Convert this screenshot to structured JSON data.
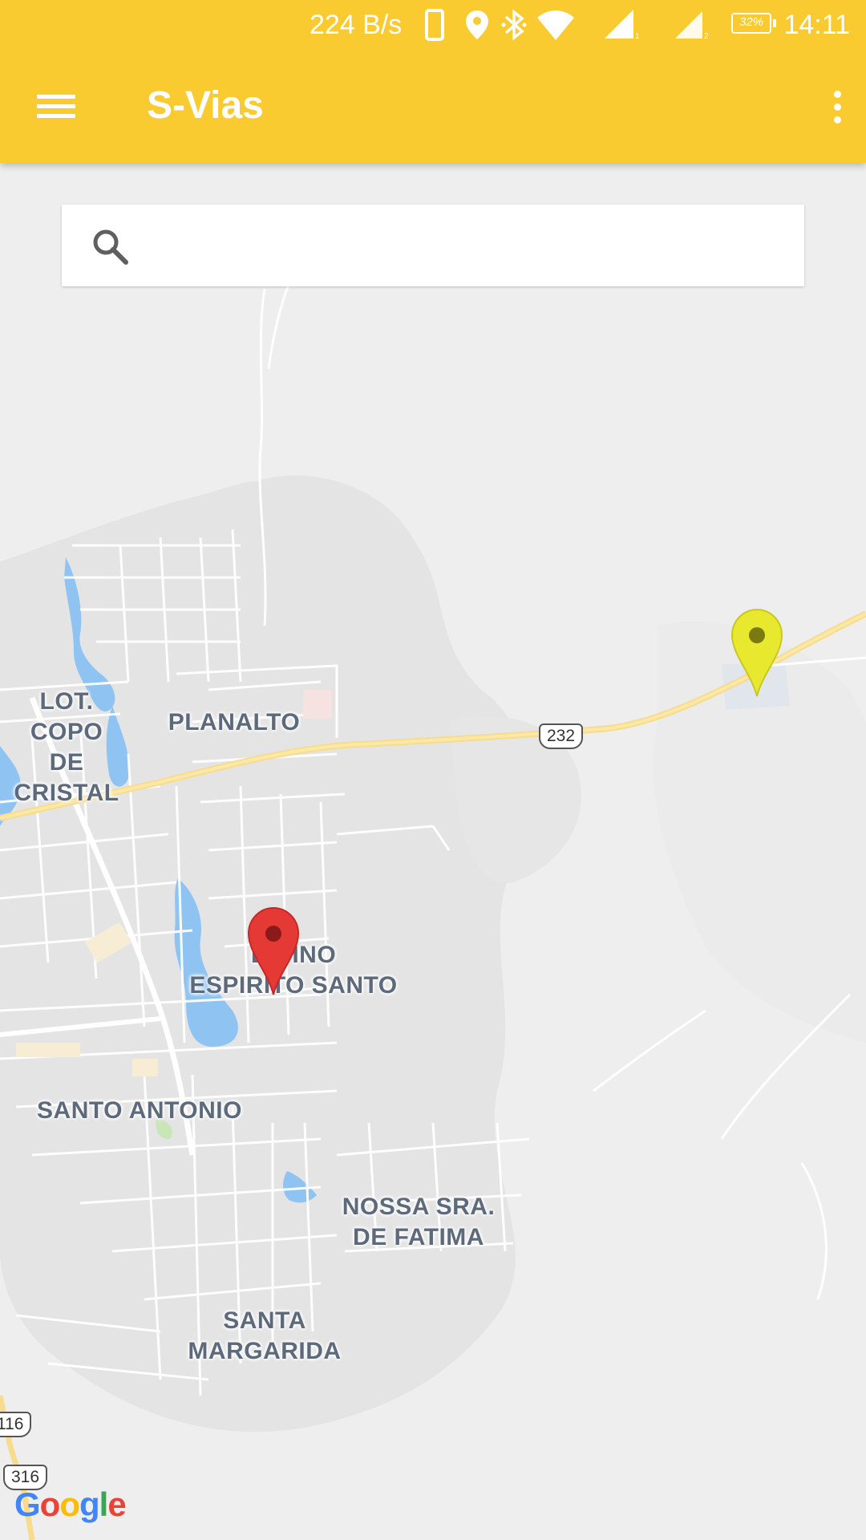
{
  "status_bar": {
    "net_speed": "224 B/s",
    "battery": "32%",
    "time": "14:11",
    "icons": [
      "phone-icon",
      "location-icon",
      "bluetooth-icon",
      "wifi-icon",
      "signal-sim1-icon",
      "signal-sim2-icon",
      "battery-icon"
    ]
  },
  "app_bar": {
    "title": "S-Vias",
    "menu_icon": "hamburger-menu-icon",
    "overflow_icon": "more-vert-icon",
    "color": "#f9cb30"
  },
  "search": {
    "placeholder": "",
    "value": "",
    "icon": "search-icon"
  },
  "map": {
    "labels": {
      "lot_copo": "LOT. COPO\nDE CRISTAL",
      "planalto": "PLANALTO",
      "divino": "DIVINO\nESPIRITO SANTO",
      "santo_antonio": "SANTO ANTONIO",
      "nossa_sra": "NOSSA SRA.\nDE FATIMA",
      "santa_margarida": "SANTA\nMARGARIDA"
    },
    "road_shields": {
      "br232": "232",
      "br116": "116",
      "br316": "316"
    },
    "markers": [
      {
        "name": "current-location-marker",
        "color": "#e53935"
      },
      {
        "name": "destination-marker",
        "color": "#e8e82e"
      }
    ],
    "attribution": "Google"
  }
}
